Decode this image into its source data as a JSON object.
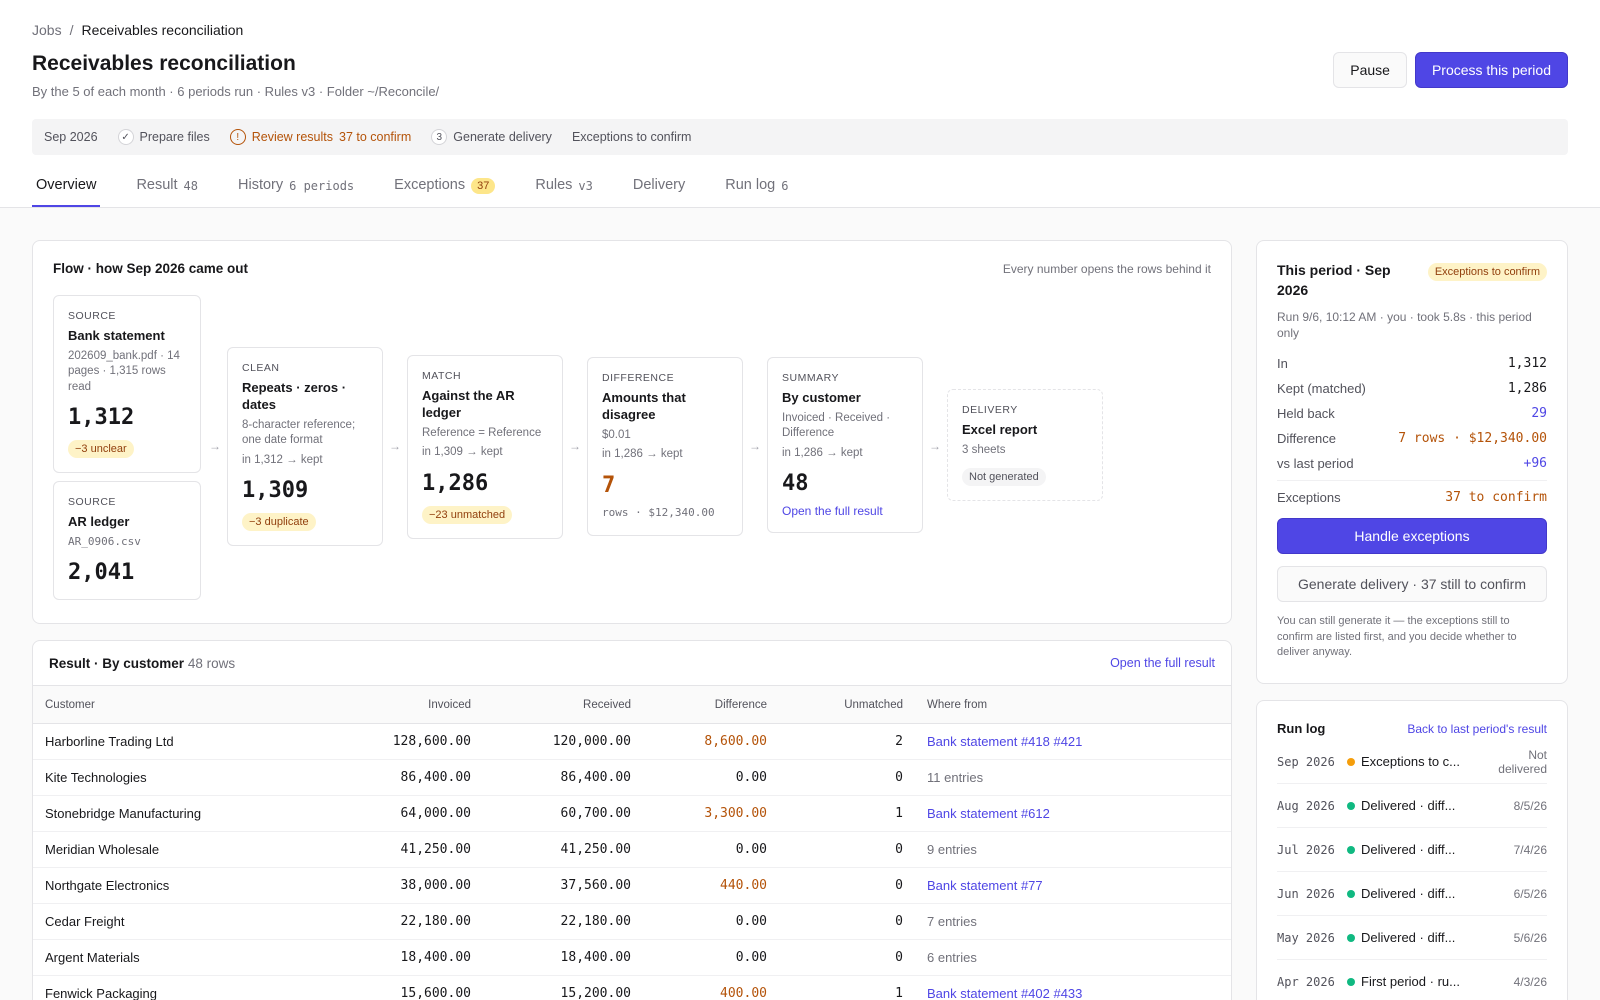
{
  "breadcrumb": {
    "parent": "Jobs",
    "separator": "/",
    "current": "Receivables reconciliation"
  },
  "header": {
    "title": "Receivables reconciliation",
    "subtitle": "By the 5 of each month · 6 periods run · Rules v3 · Folder ~/Reconcile/",
    "pause_label": "Pause",
    "process_label": "Process this period"
  },
  "steps": {
    "period": "Sep 2026",
    "prepare": "Prepare files",
    "review": "Review results",
    "review_count": "37 to confirm",
    "generate_num": "3",
    "generate": "Generate delivery",
    "exceptions": "Exceptions to confirm"
  },
  "tabs": [
    {
      "label": "Overview",
      "count": ""
    },
    {
      "label": "Result",
      "count": "48"
    },
    {
      "label": "History",
      "count": "6 periods"
    },
    {
      "label": "Exceptions",
      "count": "37"
    },
    {
      "label": "Rules",
      "count": "v3"
    },
    {
      "label": "Delivery",
      "count": ""
    },
    {
      "label": "Run log",
      "count": "6"
    }
  ],
  "flow": {
    "title": "Flow · how Sep 2026 came out",
    "note": "Every number opens the rows behind it",
    "bank": {
      "kind": "SOURCE",
      "name": "Bank statement",
      "desc": "202609_bank.pdf · 14 pages · 1,315 rows read",
      "value": "1,312",
      "badge": "−3 unclear"
    },
    "ar": {
      "kind": "SOURCE",
      "name": "AR ledger",
      "desc": "AR_0906.csv",
      "value": "2,041"
    },
    "clean": {
      "kind": "CLEAN",
      "name": "Repeats · zeros · dates",
      "desc": "8-character reference; one date format",
      "flow": "in 1,312 → kept",
      "value": "1,309",
      "badge": "−3 duplicate"
    },
    "match": {
      "kind": "MATCH",
      "name": "Against the AR ledger",
      "desc": "Reference = Reference",
      "flow": "in 1,309 → kept",
      "value": "1,286",
      "badge": "−23 unmatched"
    },
    "difference": {
      "kind": "DIFFERENCE",
      "name": "Amounts that disagree",
      "desc": "$0.01",
      "flow": "in 1,286 → kept",
      "value": "7",
      "sub": "rows · $12,340.00"
    },
    "summary": {
      "kind": "SUMMARY",
      "name": "By customer",
      "desc": "Invoiced · Received · Difference",
      "flow": "in 1,286 → kept",
      "value": "48",
      "link": "Open the full result"
    },
    "delivery": {
      "kind": "DELIVERY",
      "name": "Excel report",
      "desc": "3 sheets",
      "badge": "Not generated"
    }
  },
  "result": {
    "title": "Result · By customer",
    "rows_label": "48 rows",
    "open_link": "Open the full result",
    "columns": [
      "Customer",
      "Invoiced",
      "Received",
      "Difference",
      "Unmatched",
      "Where from"
    ],
    "rows": [
      {
        "customer": "Harborline Trading Ltd",
        "invoiced": "128,600.00",
        "received": "120,000.00",
        "difference": "8,600.00",
        "unmatched": "2",
        "where": "Bank statement #418 #421"
      },
      {
        "customer": "Kite Technologies",
        "invoiced": "86,400.00",
        "received": "86,400.00",
        "difference": "0.00",
        "unmatched": "0",
        "where": "11 entries"
      },
      {
        "customer": "Stonebridge Manufacturing",
        "invoiced": "64,000.00",
        "received": "60,700.00",
        "difference": "3,300.00",
        "unmatched": "1",
        "where": "Bank statement #612"
      },
      {
        "customer": "Meridian Wholesale",
        "invoiced": "41,250.00",
        "received": "41,250.00",
        "difference": "0.00",
        "unmatched": "0",
        "where": "9 entries"
      },
      {
        "customer": "Northgate Electronics",
        "invoiced": "38,000.00",
        "received": "37,560.00",
        "difference": "440.00",
        "unmatched": "0",
        "where": "Bank statement #77"
      },
      {
        "customer": "Cedar Freight",
        "invoiced": "22,180.00",
        "received": "22,180.00",
        "difference": "0.00",
        "unmatched": "0",
        "where": "7 entries"
      },
      {
        "customer": "Argent Materials",
        "invoiced": "18,400.00",
        "received": "18,400.00",
        "difference": "0.00",
        "unmatched": "0",
        "where": "6 entries"
      },
      {
        "customer": "Fenwick Packaging",
        "invoiced": "15,600.00",
        "received": "15,200.00",
        "difference": "400.00",
        "unmatched": "1",
        "where": "Bank statement #402 #433"
      }
    ]
  },
  "period": {
    "title": "This period · Sep 2026",
    "badge": "Exceptions to confirm",
    "meta": "Run 9/6, 10:12 AM · you · took 5.8s · this period only",
    "stats": [
      {
        "label": "In",
        "value": "1,312"
      },
      {
        "label": "Kept (matched)",
        "value": "1,286"
      },
      {
        "label": "Held back",
        "value": "29"
      },
      {
        "label": "Difference",
        "value": "7 rows · $12,340.00"
      },
      {
        "label": "vs last period",
        "value": "+96"
      }
    ],
    "exceptions_label": "Exceptions",
    "exceptions_value": "37 to confirm",
    "handle_label": "Handle exceptions",
    "generate_label": "Generate delivery · 37 still to confirm",
    "help": "You can still generate it — the exceptions still to confirm are listed first, and you decide whether to deliver anyway."
  },
  "runlog": {
    "title": "Run log",
    "back_link": "Back to last period's result",
    "items": [
      {
        "date": "Sep 2026",
        "label": "Exceptions to c...",
        "when": "Not delivered",
        "status_color": "#f59e0b"
      },
      {
        "date": "Aug 2026",
        "label": "Delivered · diff...",
        "when": "8/5/26",
        "status_color": "#10b981"
      },
      {
        "date": "Jul 2026",
        "label": "Delivered · diff...",
        "when": "7/4/26",
        "status_color": "#10b981"
      },
      {
        "date": "Jun 2026",
        "label": "Delivered · diff...",
        "when": "6/5/26",
        "status_color": "#10b981"
      },
      {
        "date": "May 2026",
        "label": "Delivered · diff...",
        "when": "5/6/26",
        "status_color": "#10b981"
      },
      {
        "date": "Apr 2026",
        "label": "First period · ru...",
        "when": "4/3/26",
        "status_color": "#10b981"
      }
    ]
  }
}
